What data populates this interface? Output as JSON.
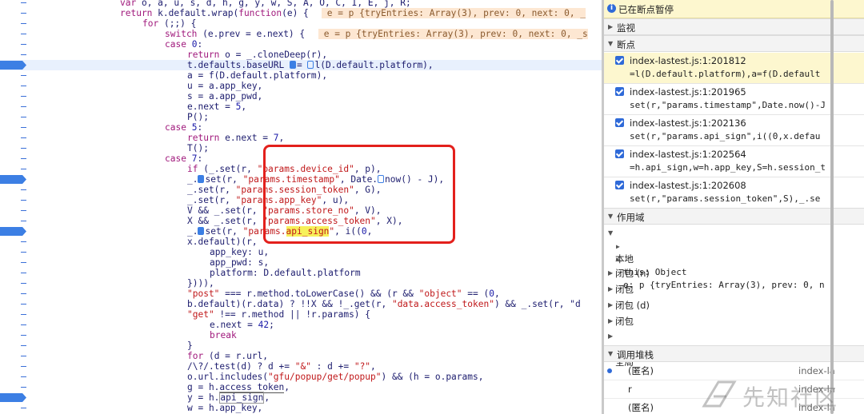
{
  "code_lines": [
    {
      "i": 0,
      "text": "var o, a, u, s, d, h, g, y, w, S, A, O, C, I, E, j, R;"
    },
    {
      "i": 1,
      "text": "return k.default.wrap(function(e) {",
      "inline": "e = p {tryEntries: Array(3), prev: 0, next: 0, _"
    },
    {
      "i": 2,
      "text": "for (;;) {"
    },
    {
      "i": 3,
      "text": "switch (e.prev = e.next) {",
      "inline": "e = p {tryEntries: Array(3), prev: 0, next: 0, _s"
    },
    {
      "i": 4,
      "text": "case 0:"
    },
    {
      "i": 5,
      "text": "return o = _.cloneDeep(r),"
    },
    {
      "i": 6,
      "text": "t.defaults.baseURL = l(D.default.platform),",
      "bp": true
    },
    {
      "i": 7,
      "text": "a = f(D.default.platform),"
    },
    {
      "i": 8,
      "text": "u = a.app_key,"
    },
    {
      "i": 9,
      "text": "s = a.app_pwd,"
    },
    {
      "i": 10,
      "text": "e.next = 5,"
    },
    {
      "i": 11,
      "text": "P();"
    },
    {
      "i": 12,
      "text": "case 5:"
    },
    {
      "i": 13,
      "text": "return e.next = 7,"
    },
    {
      "i": 14,
      "text": "T();"
    },
    {
      "i": 15,
      "text": "case 7:"
    },
    {
      "i": 16,
      "text": "if (_.set(r, \"params.device_id\", p),"
    },
    {
      "i": 17,
      "text": "_.set(r, \"params.timestamp\", Date.now() - J),",
      "bp": true
    },
    {
      "i": 18,
      "text": "_.set(r, \"params.session_token\", G),"
    },
    {
      "i": 19,
      "text": "_.set(r, \"params.app_key\", u),"
    },
    {
      "i": 20,
      "text": "V && _.set(r, \"params.store_no\", V),"
    },
    {
      "i": 21,
      "text": "X && _.set(r, \"params.access_token\", X),"
    },
    {
      "i": 22,
      "text": "_.set(r, \"params.api_sign\", i((0,",
      "bp": true
    },
    {
      "i": 23,
      "text": "x.default)(r,"
    },
    {
      "i": 24,
      "text": "app_key: u,"
    },
    {
      "i": 25,
      "text": "app_pwd: s,"
    },
    {
      "i": 26,
      "text": "platform: D.default.platform"
    },
    {
      "i": 27,
      "text": "}))),"
    },
    {
      "i": 28,
      "text": "\"post\" === r.method.toLowerCase() && (r && \"object\" == (0,"
    },
    {
      "i": 29,
      "text": "b.default)(r.data) ? !!X && !_.get(r, \"data.access_token\") && _.set(r, \"d"
    },
    {
      "i": 30,
      "text": "\"get\" !== r.method || !r.params) {"
    },
    {
      "i": 31,
      "text": "e.next = 42;"
    },
    {
      "i": 32,
      "text": "break"
    },
    {
      "i": 33,
      "text": "}"
    },
    {
      "i": 34,
      "text": "for (d = r.url,"
    },
    {
      "i": 35,
      "text": "/\\?/.test(d) ? d += \"&\" : d += \"?\","
    },
    {
      "i": 36,
      "text": "o.url.includes(\"gfu/popup/get/popup\") && (h = o.params,"
    },
    {
      "i": 37,
      "text": "g = h.access_token,"
    },
    {
      "i": 38,
      "text": "y = h.api_sign,",
      "bp": true
    },
    {
      "i": 39,
      "text": "w = h.app_key,"
    }
  ],
  "sidebar": {
    "paused": "已在断点暂停",
    "watch": "监视",
    "breakpoints_title": "断点",
    "breakpoints": [
      {
        "file": "index-lastest.js:1:201812",
        "code": "=l(D.default.platform),a=f(D.default"
      },
      {
        "file": "index-lastest.js:1:201965",
        "code": "set(r,\"params.timestamp\",Date.now()-J"
      },
      {
        "file": "index-lastest.js:1:202136",
        "code": "set(r,\"params.api_sign\",i((0,x.defau"
      },
      {
        "file": "index-lastest.js:1:202564",
        "code": "=h.api_sign,w=h.app_key,S=h.session_t"
      },
      {
        "file": "index-lastest.js:1:202608",
        "code": "set(r,\"params.session_token\",S),_.se"
      }
    ],
    "scope_title": "作用域",
    "local": "本地",
    "this_row": "this: Object",
    "e_row": "e: p {tryEntries: Array(3), prev: 0, n",
    "closures": [
      "闭包 (n)",
      "闭包",
      "闭包 (d)",
      "闭包"
    ],
    "global": "全局",
    "callstack_title": "调用堆栈",
    "stack": [
      {
        "name": "(匿名)",
        "src": "index-la"
      },
      {
        "name": "r",
        "src": "index-la"
      },
      {
        "name": "(匿名)",
        "src": "index-la"
      }
    ]
  },
  "watermark": "先知社区"
}
